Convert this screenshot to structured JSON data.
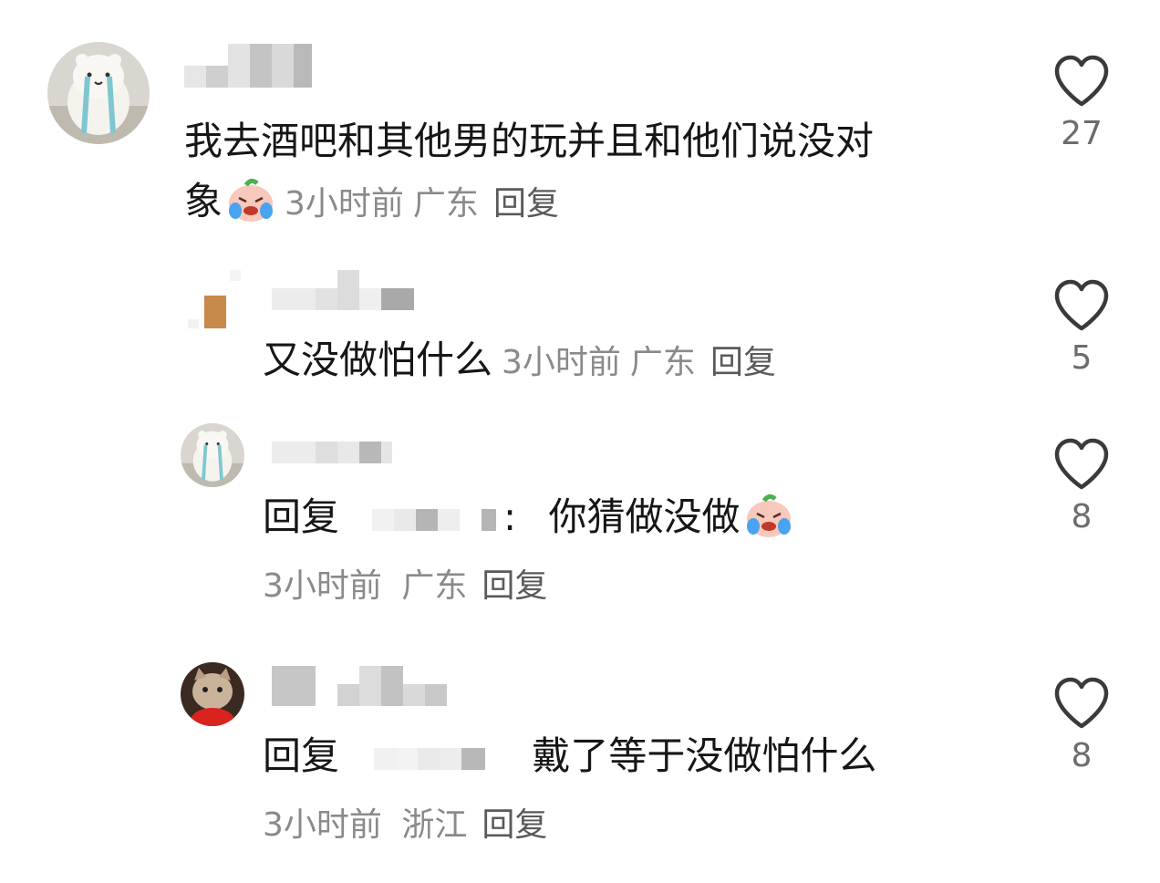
{
  "comments": [
    {
      "text": "我去酒吧和其他男的玩并且和他们说没对",
      "text_cont": "象",
      "time": "3小时前",
      "location": "广东",
      "reply_label": "回复",
      "likes": "27"
    },
    {
      "text": "又没做怕什么",
      "time": "3小时前",
      "location": "广东",
      "reply_label": "回复",
      "likes": "5"
    },
    {
      "reply_prefix": "回复",
      "colon": ":",
      "text": "你猜做没做",
      "time": "3小时前",
      "location": "广东",
      "reply_label": "回复",
      "likes": "8"
    },
    {
      "reply_prefix": "回复",
      "text": "戴了等于没做怕什么",
      "time": "3小时前",
      "location": "浙江",
      "reply_label": "回复",
      "likes": "8"
    }
  ],
  "icons": {
    "like": "heart-outline-icon",
    "emoji": "crying-laughing-sticker-icon"
  },
  "colors": {
    "meta": "#8a8a8a",
    "text": "#161616",
    "blur": "#c8c8c8"
  }
}
